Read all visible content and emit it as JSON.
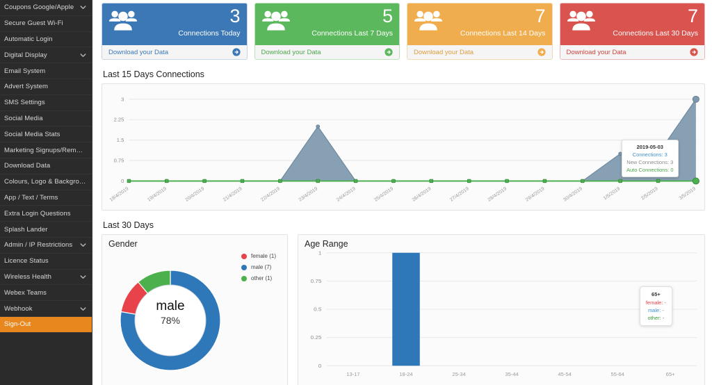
{
  "sidebar": {
    "items": [
      {
        "label": "Coupons Google/Apple",
        "icon": "chevron-down-icon",
        "expandable": true,
        "active": false
      },
      {
        "label": "Secure Guest Wi-Fi",
        "expandable": false,
        "active": false
      },
      {
        "label": "Automatic Login",
        "expandable": false,
        "active": false
      },
      {
        "label": "Digital Display",
        "icon": "chevron-down-icon",
        "expandable": true,
        "active": false
      },
      {
        "label": "Email System",
        "expandable": false,
        "active": false
      },
      {
        "label": "Advert System",
        "expandable": false,
        "active": false
      },
      {
        "label": "SMS Settings",
        "expandable": false,
        "active": false
      },
      {
        "label": "Social Media",
        "expandable": false,
        "active": false
      },
      {
        "label": "Social Media Stats",
        "expandable": false,
        "active": false
      },
      {
        "label": "Marketing Signups/Removals",
        "expandable": false,
        "active": false
      },
      {
        "label": "Download Data",
        "expandable": false,
        "active": false
      },
      {
        "label": "Colours, Logo & Background",
        "expandable": false,
        "active": false
      },
      {
        "label": "App / Text / Terms",
        "expandable": false,
        "active": false
      },
      {
        "label": "Extra Login Questions",
        "expandable": false,
        "active": false
      },
      {
        "label": "Splash Lander",
        "expandable": false,
        "active": false
      },
      {
        "label": "Admin / IP Restrictions",
        "icon": "chevron-down-icon",
        "expandable": true,
        "active": false
      },
      {
        "label": "Licence Status",
        "expandable": false,
        "active": false
      },
      {
        "label": "Wireless Health",
        "icon": "chevron-down-icon",
        "expandable": true,
        "active": false
      },
      {
        "label": "Webex Teams",
        "expandable": false,
        "active": false
      },
      {
        "label": "Webhook",
        "icon": "chevron-down-icon",
        "expandable": true,
        "active": false
      },
      {
        "label": "Sign-Out",
        "expandable": false,
        "active": true
      }
    ],
    "active_color": "#e8871e"
  },
  "cards": [
    {
      "value": "3",
      "caption": "Connections Today",
      "footer_label": "Download your Data",
      "color": "#3b78b5",
      "icon": "users-icon",
      "arrow": "arrow-right-circle-icon"
    },
    {
      "value": "5",
      "caption": "Connections Last 7 Days",
      "footer_label": "Download your Data",
      "color": "#5cb85c",
      "icon": "users-icon",
      "arrow": "arrow-right-circle-icon"
    },
    {
      "value": "7",
      "caption": "Connections Last 14 Days",
      "footer_label": "Download your Data",
      "color": "#f0ad4e",
      "icon": "users-icon",
      "arrow": "arrow-right-circle-icon"
    },
    {
      "value": "7",
      "caption": "Connections Last 30 Days",
      "footer_label": "Download your Data",
      "color": "#d9534f",
      "icon": "users-icon",
      "arrow": "arrow-right-circle-icon"
    }
  ],
  "sections": {
    "line_section_title": "Last 15 Days Connections",
    "bottom_section_title": "Last 30 Days"
  },
  "line_tooltip": {
    "date": "2019-05-03",
    "rows": [
      {
        "label": "Connections: 3",
        "color": "#3b8fd4"
      },
      {
        "label": "New Connections: 3",
        "color": "#8a8a8a"
      },
      {
        "label": "Auto Connections: 0",
        "color": "#4ca64c"
      }
    ]
  },
  "gender": {
    "title": "Gender",
    "center_label": "male",
    "center_pct": "78%",
    "legend": [
      {
        "label": "female (1)",
        "color": "#e8434a"
      },
      {
        "label": "male (7)",
        "color": "#2e77b8"
      },
      {
        "label": "other (1)",
        "color": "#4cb04c"
      }
    ]
  },
  "age_tooltip": {
    "title": "65+",
    "rows": [
      {
        "label": "female: -",
        "color": "#e8434a"
      },
      {
        "label": "male: -",
        "color": "#3b8fd4"
      },
      {
        "label": "other: -",
        "color": "#3a9c3a"
      }
    ]
  },
  "chart_data": [
    {
      "type": "area",
      "title": "Last 15 Days Connections",
      "xlabel": "",
      "ylabel": "",
      "ylim": [
        0,
        3
      ],
      "yticks": [
        "0",
        "0.75",
        "1.5",
        "2.25",
        "3"
      ],
      "grid": true,
      "legend_position": "none",
      "categories": [
        "18/4/2019",
        "19/4/2019",
        "20/4/2019",
        "21/4/2019",
        "22/4/2019",
        "23/4/2019",
        "24/4/2019",
        "25/4/2019",
        "26/4/2019",
        "27/4/2019",
        "28/4/2019",
        "29/4/2019",
        "30/4/2019",
        "1/5/2019",
        "2/5/2019",
        "3/5/2019"
      ],
      "series": [
        {
          "name": "Connections",
          "color": "#7e98ad",
          "values": [
            0,
            0,
            0,
            0,
            0,
            2,
            0,
            0,
            0,
            0,
            0,
            0,
            0,
            1,
            1,
            3
          ]
        },
        {
          "name": "Auto Connections",
          "color": "#4caf50",
          "values": [
            0,
            0,
            0,
            0,
            0,
            0,
            0,
            0,
            0,
            0,
            0,
            0,
            0,
            0,
            0,
            0
          ]
        }
      ],
      "annotation": "2019-05-03 | Connections: 3 | New Connections: 3 | Auto Connections: 0"
    },
    {
      "type": "pie",
      "title": "Gender",
      "center_text": "male 78%",
      "legend_position": "top-right",
      "categories": [
        "female",
        "male",
        "other"
      ],
      "values": [
        1,
        7,
        1
      ],
      "colors": [
        "#e8434a",
        "#2e77b8",
        "#4cb04c"
      ]
    },
    {
      "type": "bar",
      "title": "Age Range",
      "xlabel": "",
      "ylabel": "",
      "ylim": [
        0,
        1
      ],
      "yticks": [
        "0",
        "0.25",
        "0.5",
        "0.75",
        "1"
      ],
      "grid": true,
      "legend_position": "none",
      "categories": [
        "13-17",
        "18-24",
        "25-34",
        "35-44",
        "45-54",
        "55-64",
        "65+"
      ],
      "values": [
        0,
        1,
        0,
        0,
        0,
        0,
        0
      ],
      "colors": [
        "#2e77b8"
      ]
    }
  ]
}
